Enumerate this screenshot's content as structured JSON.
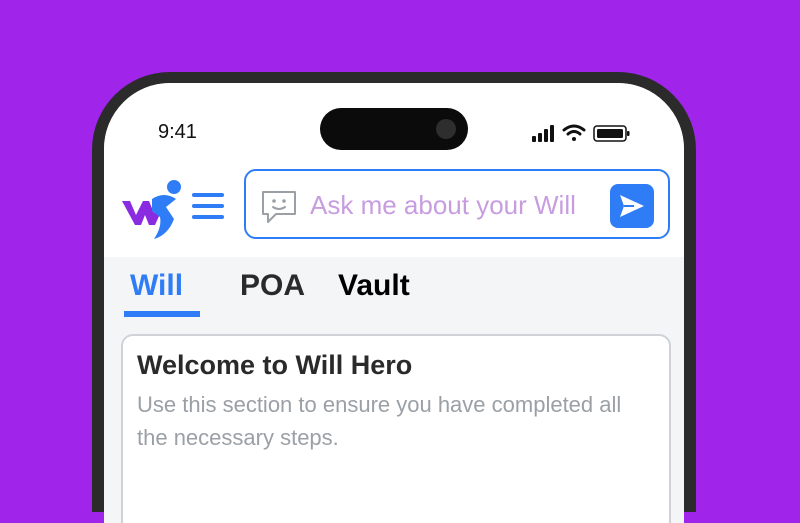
{
  "status_bar": {
    "time": "9:41",
    "icons": [
      "cellular-signal-icon",
      "wifi-icon",
      "battery-icon"
    ]
  },
  "header": {
    "logo_icon": "will-hero-logo-icon",
    "menu_icon": "hamburger-menu-icon",
    "search": {
      "placeholder": "Ask me about your Will",
      "value": "",
      "chat_icon": "chat-bubble-icon",
      "send_icon": "send-arrow-icon"
    }
  },
  "tabs": [
    {
      "label": "Will",
      "active": true
    },
    {
      "label": "POA",
      "active": false
    },
    {
      "label": "Vault",
      "active": false
    }
  ],
  "card": {
    "title": "Welcome to Will Hero",
    "description": "Use this section to ensure you have completed all the necessary steps."
  },
  "colors": {
    "background": "#a024ea",
    "accent": "#2f7df6",
    "placeholder": "#c79de0",
    "logo_purple": "#8a2be2"
  }
}
